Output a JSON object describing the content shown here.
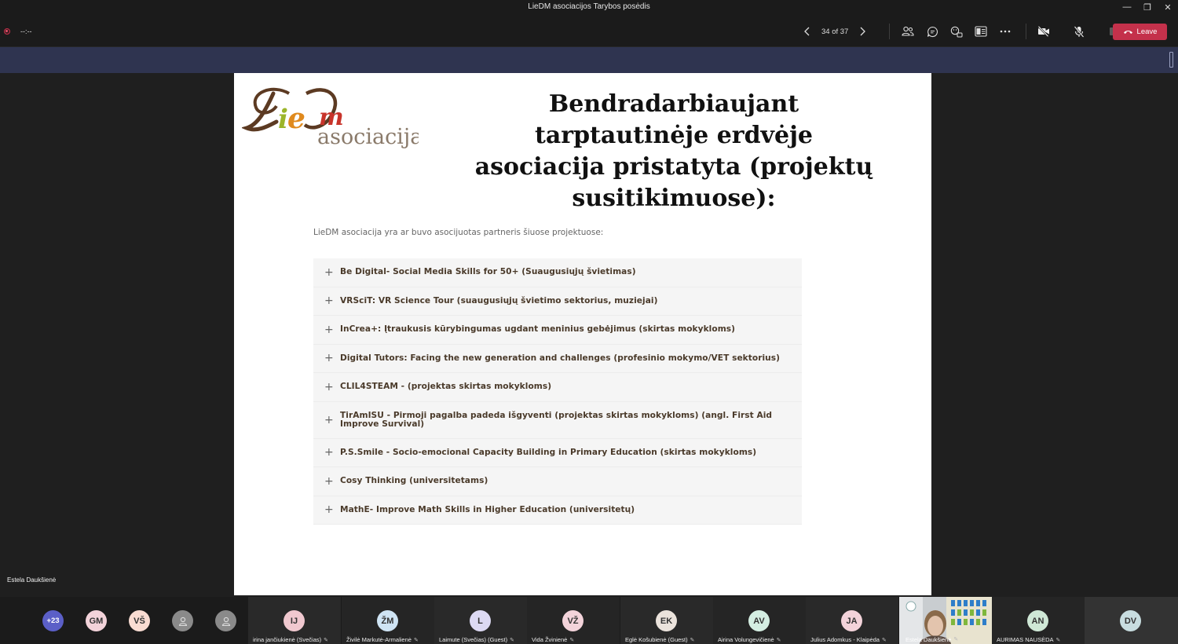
{
  "window": {
    "title": "LieDM asociacijos Tarybos posėdis",
    "controls": [
      "—",
      "❐",
      "✕"
    ]
  },
  "toolbar": {
    "timer": "--:--",
    "slide_counter": "34 of 37",
    "leave_label": "Leave",
    "colors": {
      "leave": "#c4314b",
      "recording": "#c4314b"
    },
    "icons": [
      "people-icon",
      "chat-icon",
      "reactions-icon",
      "rooms-icon",
      "more-icon",
      "camera-off-icon",
      "mic-off-icon",
      "share-icon"
    ]
  },
  "presenter": {
    "name": "Estela Daukšienė"
  },
  "slide": {
    "logo": {
      "brand": "LieDm",
      "subtitle": "asociacija"
    },
    "title": "Bendradarbiaujant tarptautinėje erdvėje asociacija pristatyta (projektų susitikimuose):",
    "intro": "LieDM asociacija yra ar buvo asocijuotas partneris šiuose projektuose:",
    "projects": [
      "Be Digital- Social Media Skills for 50+ (Suaugusiųjų švietimas)",
      "VRSciT: VR Science Tour (suaugusiųjų švietimo sektorius, muziejai)",
      "InCrea+: Įtraukusis kūrybingumas ugdant meninius gebėjimus (skirtas mokykloms)",
      "Digital Tutors: Facing the new generation and challenges (profesinio mokymo/VET sektorius)",
      "CLIL4STEAM - (projektas skirtas mokykloms)",
      "TirAmISU - Pirmoji pagalba padeda išgyventi (projektas skirtas mokykloms) (angl. First Aid Improve Survival)",
      "P.S.Smile - Socio-emocional Capacity Building in Primary Education (skirtas mokykloms)",
      "Cosy Thinking (universitetams)",
      "MathE- Improve Math Skills in Higher Education (universitetų)"
    ]
  },
  "participants": {
    "overflow": "+23",
    "small": [
      {
        "initials": "GM",
        "color": "#f3d3da"
      },
      {
        "initials": "VŠ",
        "color": "#f9dcd2"
      }
    ],
    "tiles": [
      {
        "initials": "IJ",
        "name": "irina jančiukienė (Svečias)",
        "color": "#f0c8cf"
      },
      {
        "initials": "ŽM",
        "name": "Živilė Markutė-Armalienė",
        "color": "#cfe4f4"
      },
      {
        "initials": "L",
        "name": "Laimute (Svečias) (Guest)",
        "color": "#dcd9f3"
      },
      {
        "initials": "VŽ",
        "name": "Vida Žvinienė",
        "color": "#f3d3da"
      },
      {
        "initials": "EK",
        "name": "Eglė Košubienė (Guest)",
        "color": "#ebe3dc"
      },
      {
        "initials": "AV",
        "name": "Airina Volungevičienė",
        "color": "#d4eee2"
      },
      {
        "initials": "JA",
        "name": "Julius Adomkus - Klaipėda",
        "color": "#f3d3da"
      },
      {
        "initials": "AN",
        "name": "AURIMAS NAUSĖDA",
        "color": "#cfe8d6"
      },
      {
        "initials": "DV",
        "name": "",
        "color": "#c8dde0"
      }
    ],
    "video_name": "Estela Daukšienė"
  }
}
